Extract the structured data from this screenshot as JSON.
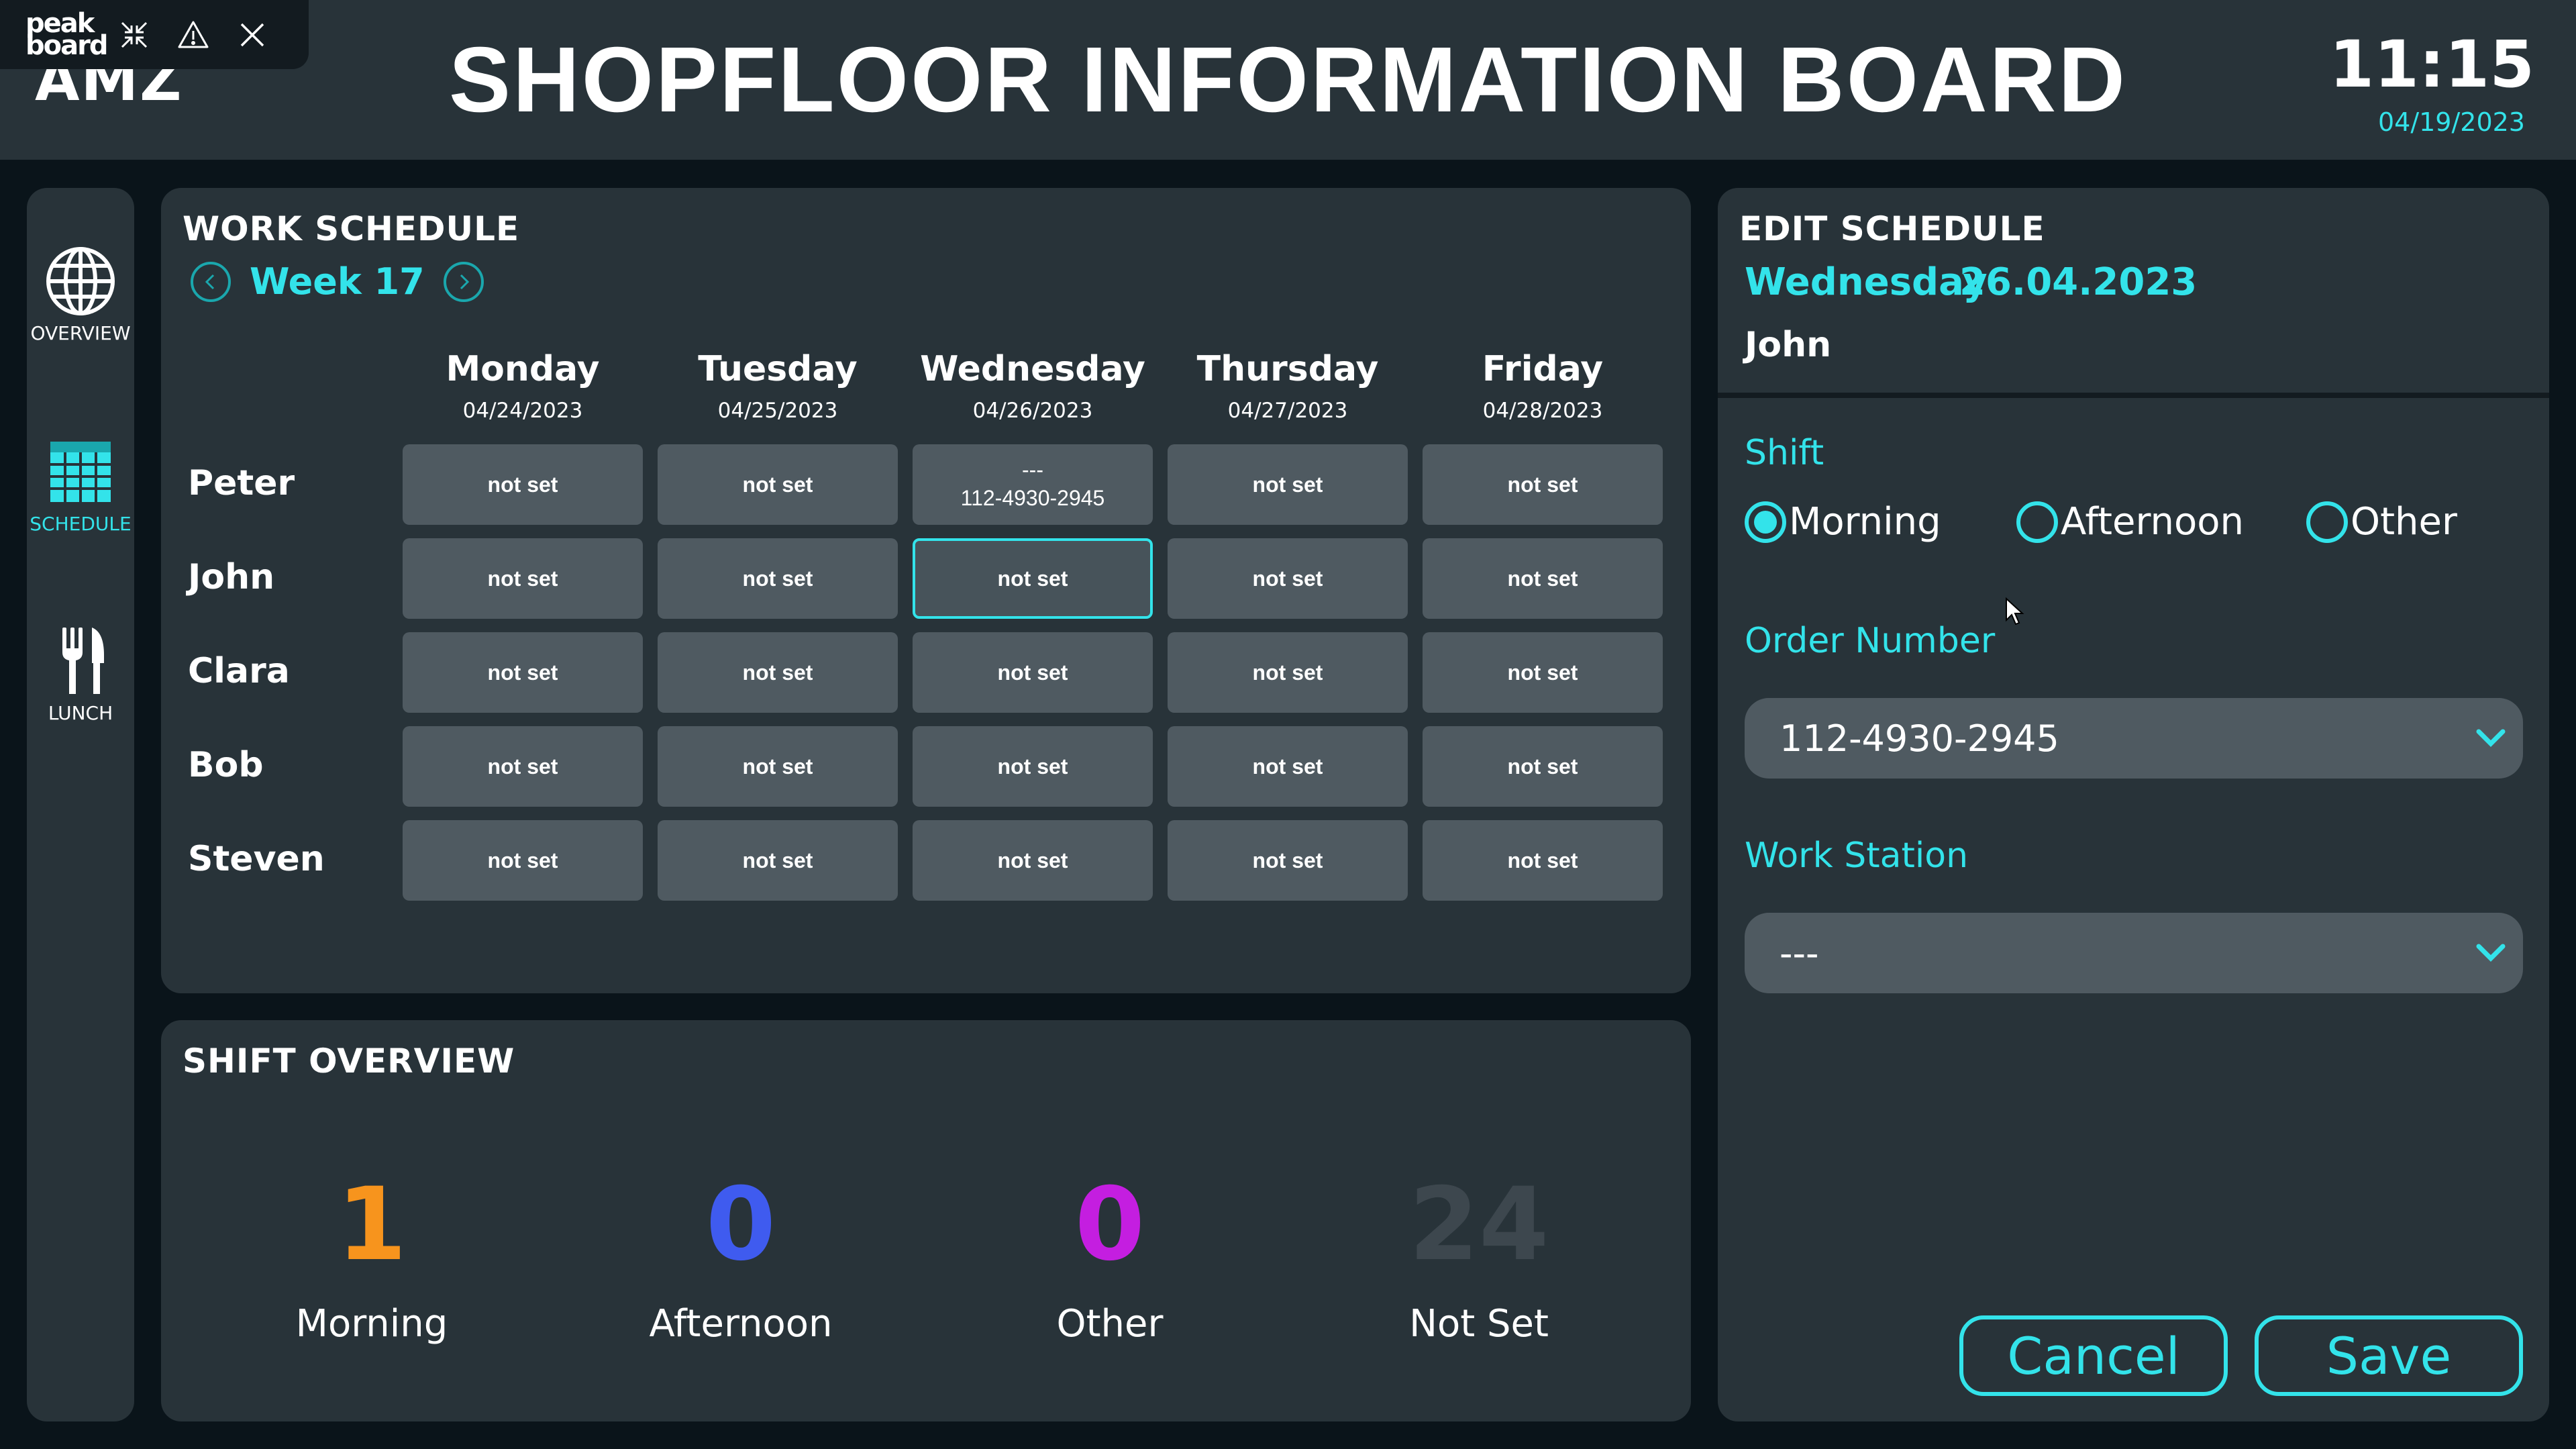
{
  "header": {
    "logo": "AMZ",
    "title": "SHOPFLOOR INFORMATION BOARD",
    "time": "11:15",
    "date": "04/19/2023"
  },
  "peakboard_toolbar": {
    "logo_line1": "peak",
    "logo_line2": "board",
    "icons": [
      "collapse-arrows-icon",
      "warning-icon",
      "close-icon"
    ]
  },
  "sidebar": {
    "items": [
      {
        "label": "OVERVIEW",
        "icon": "globe-icon",
        "active": false
      },
      {
        "label": "SCHEDULE",
        "icon": "calendar-grid-icon",
        "active": true
      },
      {
        "label": "LUNCH",
        "icon": "fork-knife-icon",
        "active": false
      }
    ]
  },
  "work_schedule": {
    "title": "WORK SCHEDULE",
    "week": "Week 17",
    "days": [
      {
        "name": "Monday",
        "date": "04/24/2023"
      },
      {
        "name": "Tuesday",
        "date": "04/25/2023"
      },
      {
        "name": "Wednesday",
        "date": "04/26/2023"
      },
      {
        "name": "Thursday",
        "date": "04/27/2023"
      },
      {
        "name": "Friday",
        "date": "04/28/2023"
      }
    ],
    "rows": [
      {
        "name": "Peter",
        "cells": [
          "not set",
          "not set",
          "---\n112-4930-2945",
          "not set",
          "not set"
        ]
      },
      {
        "name": "John",
        "cells": [
          "not set",
          "not set",
          "not set",
          "not set",
          "not set"
        ]
      },
      {
        "name": "Clara",
        "cells": [
          "not set",
          "not set",
          "not set",
          "not set",
          "not set"
        ]
      },
      {
        "name": "Bob",
        "cells": [
          "not set",
          "not set",
          "not set",
          "not set",
          "not set"
        ]
      },
      {
        "name": "Steven",
        "cells": [
          "not set",
          "not set",
          "not set",
          "not set",
          "not set"
        ]
      }
    ],
    "peter_wed_top": "---",
    "peter_wed_bottom": "112-4930-2945"
  },
  "shift_overview": {
    "title": "SHIFT OVERVIEW",
    "stats": [
      {
        "value": "1",
        "label": "Morning",
        "color": "#f7941d"
      },
      {
        "value": "0",
        "label": "Afternoon",
        "color": "#3f5bef"
      },
      {
        "value": "0",
        "label": "Other",
        "color": "#c41ee0"
      },
      {
        "value": "24",
        "label": "Not Set",
        "color": "#3d474e"
      }
    ]
  },
  "edit_schedule": {
    "title": "EDIT SCHEDULE",
    "day": "Wednesday",
    "date": "26.04.2023",
    "person": "John",
    "shift_label": "Shift",
    "shift_options": [
      "Morning",
      "Afternoon",
      "Other"
    ],
    "shift_selected": "Morning",
    "order_label": "Order Number",
    "order_value": "112-4930-2945",
    "station_label": "Work Station",
    "station_value": "---",
    "cancel": "Cancel",
    "save": "Save"
  },
  "colors": {
    "accent": "#33e3ea",
    "panel": "#283339",
    "background": "#0a141a",
    "cell": "#4f5a61"
  }
}
